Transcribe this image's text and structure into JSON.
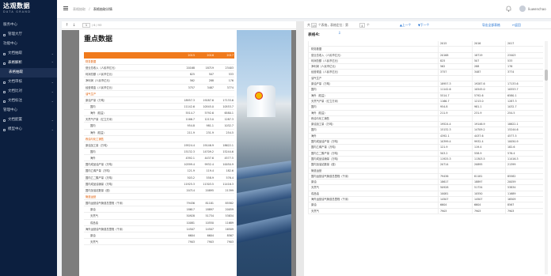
{
  "brand": {
    "name": "达观数据",
    "sub": "DATA GRAND"
  },
  "sidebar": {
    "items": [
      {
        "label": "服务中心",
        "type": "section"
      },
      {
        "label": "管理大厅",
        "type": "item",
        "caret": ""
      },
      {
        "label": "功能中心",
        "type": "section"
      },
      {
        "label": "文档抽取",
        "type": "item",
        "caret": "⌄"
      },
      {
        "label": "表格解析",
        "type": "item active",
        "caret": "⌃"
      },
      {
        "label": "表格抽取",
        "type": "selected",
        "caret": ""
      },
      {
        "label": "文档审核",
        "type": "item",
        "caret": "⌄"
      },
      {
        "label": "文档比对",
        "type": "item",
        "caret": "⌄"
      },
      {
        "label": "文档标注",
        "type": "item",
        "caret": "⌄"
      },
      {
        "label": "管理中心",
        "type": "section"
      },
      {
        "label": "文档配置",
        "type": "item",
        "caret": "⌄"
      },
      {
        "label": "模型中心",
        "type": "item",
        "caret": "⌄"
      }
    ]
  },
  "topbar": {
    "breadcrumb1": "表格抽取",
    "sep": "/",
    "breadcrumb2": "表格抽取详情",
    "user": "liuwenchao"
  },
  "pdf_toolbar": {
    "prev": "↑",
    "next": "↓",
    "page": "1",
    "total": "/ 6 / 93"
  },
  "pdf_page": {
    "title": "重点数据",
    "years": [
      "2015",
      "2016",
      "2017"
    ],
    "rows": [
      {
        "label": "财务数据",
        "v": [
          "",
          "",
          ""
        ],
        "sec": true
      },
      {
        "label": "营业总收入（人民币亿元）",
        "v": [
          "20168",
          "18719",
          "23403"
        ]
      },
      {
        "label": "利润总额（人民币亿元）",
        "v": [
          "825",
          "507",
          "533"
        ]
      },
      {
        "label": "净利润（人民币亿元）",
        "v": [
          "562",
          "288",
          "176"
        ]
      },
      {
        "label": "经营现金（人民币亿元）",
        "v": [
          "3757",
          "3487",
          "3774"
        ]
      },
      {
        "label": "油气生产",
        "v": [
          "",
          "",
          ""
        ],
        "sec": true
      },
      {
        "label": "原油产量（万吨）",
        "v": [
          "18957.3",
          "19287.6",
          "17133.6"
        ]
      },
      {
        "label": "国内",
        "v": [
          "11142.6",
          "10545.0",
          "10553.7"
        ],
        "ind": true
      },
      {
        "label": "海外（权益）",
        "v": [
          "5514.7",
          "5792.6",
          "6580.1"
        ],
        "ind": true
      },
      {
        "label": "天然气产量（亿立方米）",
        "v": [
          "1166.7",
          "1213.0",
          "1287.3"
        ]
      },
      {
        "label": "国内",
        "v": [
          "954.8",
          "981.1",
          "1032.7"
        ],
        "ind": true
      },
      {
        "label": "海外（权益）",
        "v": [
          "211.9",
          "231.9",
          "254.5"
        ],
        "ind": true
      },
      {
        "label": "炼油与化工销售",
        "v": [
          "",
          "",
          ""
        ],
        "sec": true
      },
      {
        "label": "原油加工量（万吨）",
        "v": [
          "19524.4",
          "19146.9",
          "18622.1"
        ]
      },
      {
        "label": "国内",
        "v": [
          "15132.3",
          "14709.2",
          "15244.6"
        ],
        "ind": true
      },
      {
        "label": "海外",
        "v": [
          "4392.1",
          "4437.6",
          "4577.5"
        ],
        "ind": true
      },
      {
        "label": "国内成品油产量（万吨）",
        "v": [
          "10399.4",
          "9932.4",
          "10050.9"
        ]
      },
      {
        "label": "国内乙烯产量（万吨）",
        "v": [
          "121.9",
          "119.4",
          "182.6"
        ]
      },
      {
        "label": "国内乙二醇产量（万吨）",
        "v": [
          "503.2",
          "558.9",
          "576.4"
        ]
      },
      {
        "label": "国内成品油销量（万吨）",
        "v": [
          "11925.3",
          "11303.5",
          "11416.3"
        ]
      },
      {
        "label": "国内加油站数量（座）",
        "v": [
          "20714",
          "20895",
          "21399"
        ]
      },
      {
        "label": "管道运营",
        "v": [
          "",
          "",
          ""
        ],
        "sec": true
      },
      {
        "label": "国内运营油气管道总里程（千米）",
        "v": [
          "79436",
          "81181",
          "85582"
        ]
      },
      {
        "label": "原油",
        "v": [
          "18617",
          "18897",
          "20059"
        ],
        "ind": true
      },
      {
        "label": "天然气",
        "v": [
          "50928",
          "51734",
          "53834"
        ],
        "ind": true
      },
      {
        "label": "成品油",
        "v": [
          "10081",
          "10550",
          "11689"
        ],
        "ind": true
      },
      {
        "label": "海外运营油气管道总里程（千米）",
        "v": [
          "14507",
          "14507",
          "16509"
        ]
      },
      {
        "label": "原油",
        "v": [
          "6604",
          "6604",
          "8567"
        ],
        "ind": true
      },
      {
        "label": "天然气",
        "v": [
          "7903",
          "7903",
          "7903"
        ],
        "ind": true
      }
    ]
  },
  "result_toolbar": {
    "prefix": "共",
    "count": "15",
    "mid": "个表格，表格定位：第",
    "sel": "4",
    "suffix": "个",
    "prev": "▲上一个",
    "next": "▼下一个",
    "export": "导出全部表格",
    "back": "↩返回"
  },
  "result": {
    "table_name": "表格4:",
    "download": "⇩",
    "header": [
      "",
      "2015",
      "2016",
      "2017"
    ],
    "rows": [
      [
        "财务数据",
        "",
        "",
        ""
      ],
      [
        "营业总收入（人民币亿元）",
        "20168",
        "18719",
        "23403"
      ],
      [
        "利润总额（人民币亿元）",
        "825",
        "507",
        "533"
      ],
      [
        "净利润（人民币亿元）",
        "562",
        "288",
        "176"
      ],
      [
        "经营现金（人民币亿元）",
        "3757",
        "3487",
        "3774"
      ],
      [
        "油气生产",
        "",
        "",
        ""
      ],
      [
        "原油产量（万吨）",
        "18957.3",
        "19287.6",
        "17133.6"
      ],
      [
        "国内",
        "11142.6",
        "10545.0",
        "10553.7"
      ],
      [
        "海外（权益）",
        "5514.7",
        "5792.6",
        "6580.1"
      ],
      [
        "天然气产量（亿立方米）",
        "1166.7",
        "1213.0",
        "1287.3"
      ],
      [
        "国内",
        "954.8",
        "981.1",
        "1032.7"
      ],
      [
        "海外（权益）",
        "211.9",
        "231.9",
        "254.5"
      ],
      [
        "炼油与化工销售",
        "",
        "",
        ""
      ],
      [
        "原油加工量（万吨）",
        "19524.4",
        "19146.9",
        "18622.1"
      ],
      [
        "国内",
        "15132.3",
        "14709.2",
        "15244.6"
      ],
      [
        "海外",
        "4392.1",
        "4437.6",
        "4577.5"
      ],
      [
        "国内成品油产量（万吨）",
        "10399.4",
        "9932.4",
        "10050.9"
      ],
      [
        "国内乙烯产量（万吨）",
        "121.9",
        "119.4",
        "182.6"
      ],
      [
        "国内乙二醇产量（万吨）",
        "503.2",
        "558.9",
        "576.4"
      ],
      [
        "国内成品油销量（万吨）",
        "11925.3",
        "11303.5",
        "11416.3"
      ],
      [
        "国内加油站数量（座）",
        "20714",
        "20895",
        "21399"
      ],
      [
        "管道运营",
        "",
        "",
        ""
      ],
      [
        "国内运营油气管道总里程（千米）",
        "79436",
        "81181",
        "85582"
      ],
      [
        "原油",
        "18617",
        "18897",
        "20059"
      ],
      [
        "天然气",
        "50928",
        "51734",
        "53834"
      ],
      [
        "成品油",
        "10081",
        "10550",
        "11689"
      ],
      [
        "海外运营油气管道总里程（千米）",
        "14507",
        "14507",
        "16509"
      ],
      [
        "原油",
        "6604",
        "6604",
        "8567"
      ],
      [
        "天然气",
        "7903",
        "7903",
        "7903"
      ]
    ]
  },
  "colors": {
    "sidebar": "#0c1f3f",
    "accent": "#f07a1c",
    "link": "#1d6fd1"
  }
}
